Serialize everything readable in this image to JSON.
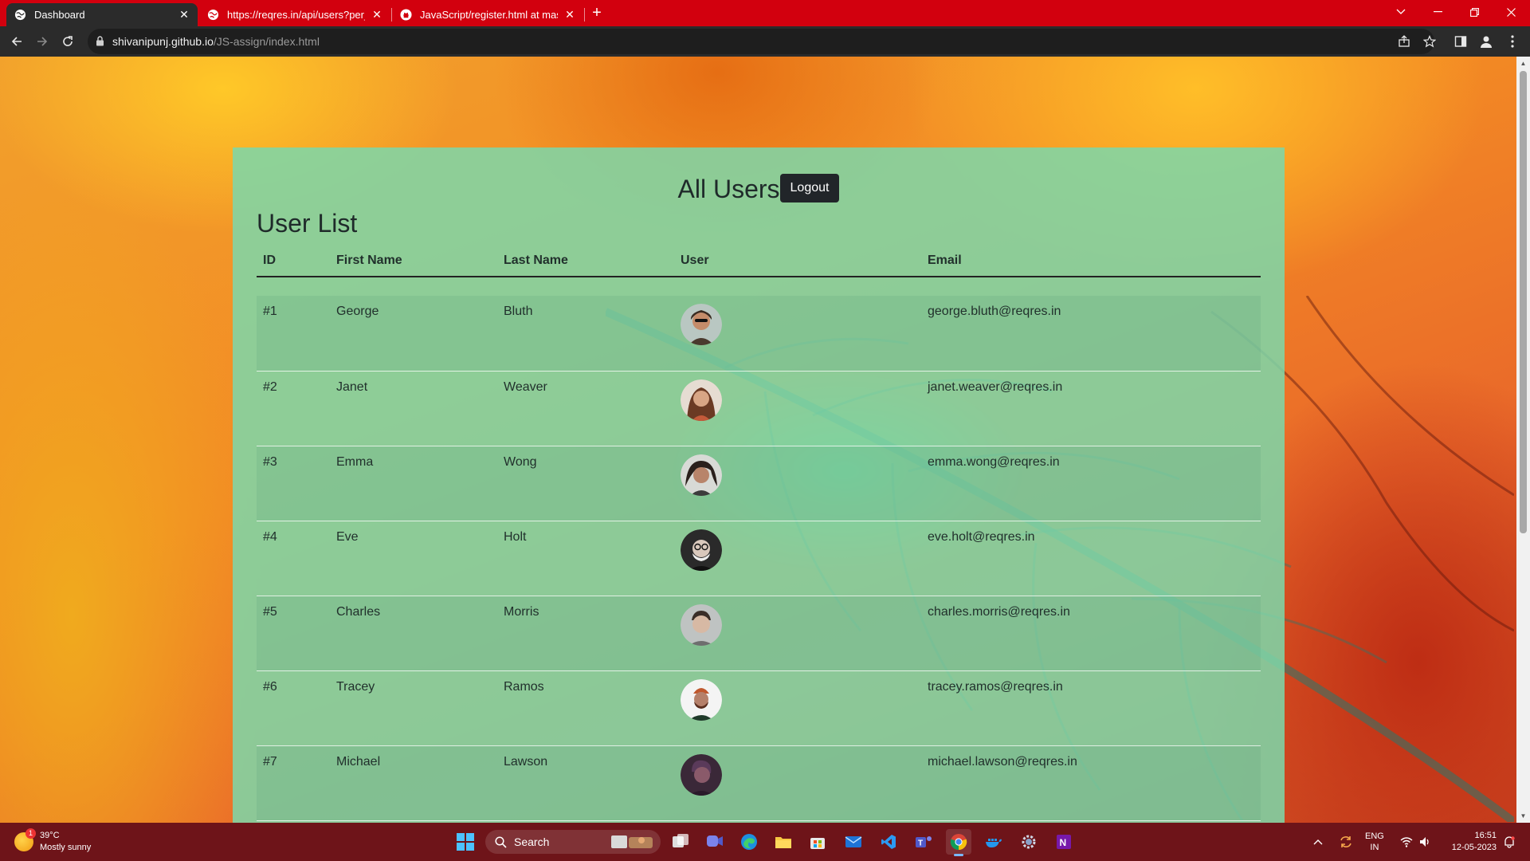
{
  "browser": {
    "tabs": [
      {
        "title": "Dashboard",
        "active": true
      },
      {
        "title": "https://reqres.in/api/users?per_p",
        "active": false
      },
      {
        "title": "JavaScript/register.html at maste",
        "active": false
      }
    ],
    "url_host": "shivanipunj.github.io",
    "url_path": "/JS-assign/index.html"
  },
  "page": {
    "title": "All Users",
    "logout_label": "Logout",
    "section_title": "User List",
    "columns": [
      "ID",
      "First Name",
      "Last Name",
      "User",
      "Email"
    ],
    "users": [
      {
        "id": "#1",
        "first": "George",
        "last": "Bluth",
        "email": "george.bluth@reqres.in",
        "avatar_color": "#4a3a2e"
      },
      {
        "id": "#2",
        "first": "Janet",
        "last": "Weaver",
        "email": "janet.weaver@reqres.in",
        "avatar_color": "#7a4a3a"
      },
      {
        "id": "#3",
        "first": "Emma",
        "last": "Wong",
        "email": "emma.wong@reqres.in",
        "avatar_color": "#5a4a46"
      },
      {
        "id": "#4",
        "first": "Eve",
        "last": "Holt",
        "email": "eve.holt@reqres.in",
        "avatar_color": "#3a3a3a"
      },
      {
        "id": "#5",
        "first": "Charles",
        "last": "Morris",
        "email": "charles.morris@reqres.in",
        "avatar_color": "#8a8a86"
      },
      {
        "id": "#6",
        "first": "Tracey",
        "last": "Ramos",
        "email": "tracey.ramos@reqres.in",
        "avatar_color": "#c0582e"
      },
      {
        "id": "#7",
        "first": "Michael",
        "last": "Lawson",
        "email": "michael.lawson@reqres.in",
        "avatar_color": "#5a3a5a"
      }
    ]
  },
  "taskbar": {
    "weather_temp": "39°C",
    "weather_desc": "Mostly sunny",
    "weather_badge": "1",
    "search_label": "Search",
    "lang_top": "ENG",
    "lang_bottom": "IN",
    "time": "16:51",
    "date": "12-05-2023"
  },
  "colors": {
    "tabbar": "#d2000e",
    "panel": "#7dd7aa",
    "logout_button": "#212529",
    "taskbar": "#6e1419"
  }
}
